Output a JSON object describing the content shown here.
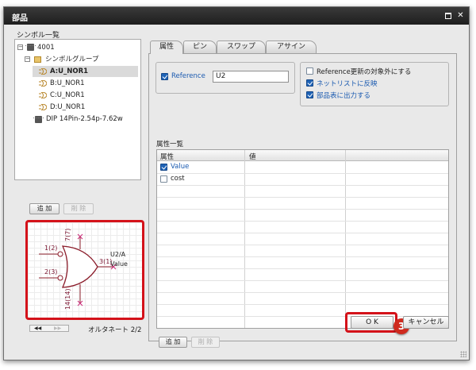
{
  "window": {
    "title": "部品"
  },
  "symbols": {
    "heading": "シンボル一覧",
    "tree": [
      {
        "label": "4001"
      },
      {
        "label": "シンボルグループ"
      },
      {
        "label": "A:U_NOR1"
      },
      {
        "label": "B:U_NOR1"
      },
      {
        "label": "C:U_NOR1"
      },
      {
        "label": "D:U_NOR1"
      },
      {
        "label": "DIP 14Pin-2.54p-7.62w"
      }
    ],
    "add_label": "追 加",
    "delete_label": "削 除"
  },
  "preview": {
    "ref": "U2/A",
    "value": "Value",
    "pin1": "1(2)",
    "pin2": "2(3)",
    "pin3": "3(1)",
    "pin_vcc": "7(7)",
    "pin_gnd": "14(14)"
  },
  "alternate": {
    "label": "オルタネート 2/2"
  },
  "tabs": [
    "属性",
    "ピン",
    "スワップ",
    "アサイン"
  ],
  "attributes": {
    "reference_label": "Reference",
    "reference_value": "U2",
    "options": [
      {
        "label": "Reference更新の対象外にする",
        "checked": false
      },
      {
        "label": "ネットリストに反映",
        "checked": true
      },
      {
        "label": "部品表に出力する",
        "checked": true
      }
    ],
    "list_heading": "属性一覧",
    "columns": [
      "属性",
      "値"
    ],
    "rows": [
      {
        "name": "Value",
        "checked": true
      },
      {
        "name": "cost",
        "checked": false
      }
    ],
    "add_label": "追 加",
    "delete_label": "削 除"
  },
  "footer": {
    "ok_label": "O K",
    "cancel_label": "キャンセル",
    "step_badge": "3"
  },
  "colors": {
    "highlight": "#d4121a",
    "badge": "#cf2a1e",
    "accent": "#1a5ab0"
  }
}
